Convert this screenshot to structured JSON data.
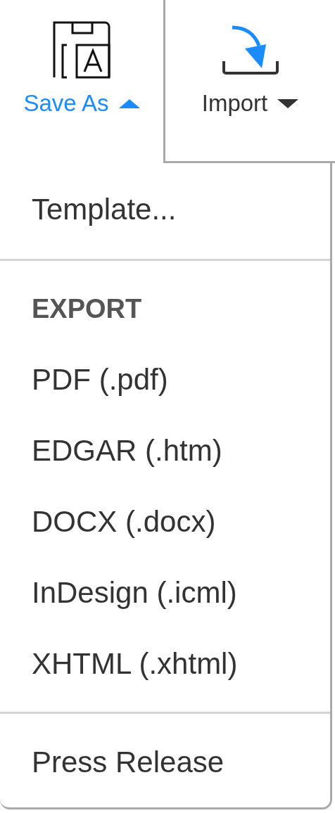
{
  "toolbar": [
    {
      "kind": "save",
      "label": "Save As",
      "selected": true
    },
    {
      "kind": "import",
      "label": "Import",
      "selected": false
    }
  ],
  "menu": {
    "sections": [
      {
        "items": [
          "Template..."
        ]
      },
      {
        "header": "EXPORT",
        "items": [
          "PDF (.pdf)",
          "EDGAR (.htm)",
          "DOCX (.docx)",
          "InDesign (.icml)",
          "XHTML (.xhtml)"
        ]
      },
      {
        "items": [
          "Press Release"
        ]
      }
    ]
  }
}
